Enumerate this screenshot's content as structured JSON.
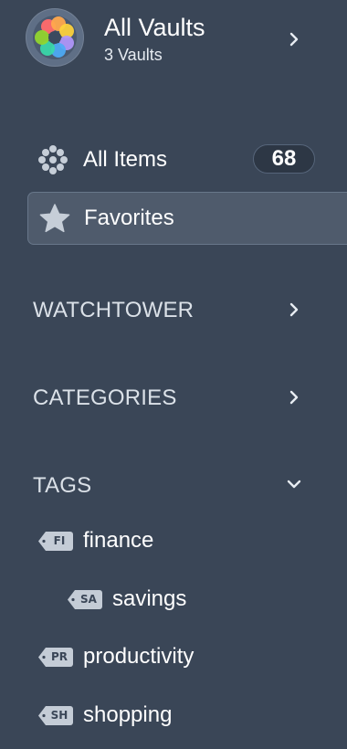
{
  "vault": {
    "title": "All Vaults",
    "subtitle": "3 Vaults",
    "icon": "rainbow-vault-icon",
    "chevron_icon": "chevron-right-icon"
  },
  "nav": [
    {
      "label": "All Items",
      "count": "68",
      "icon": "all-items-dots-icon",
      "selected": false
    },
    {
      "label": "Favorites",
      "icon": "star-icon",
      "selected": true
    }
  ],
  "sections": {
    "watchtower": {
      "label": "WATCHTOWER",
      "icon": "chevron-right-icon",
      "expanded": false
    },
    "categories": {
      "label": "CATEGORIES",
      "icon": "chevron-right-icon",
      "expanded": false
    },
    "tags": {
      "label": "TAGS",
      "icon": "chevron-down-icon",
      "expanded": true
    }
  },
  "tags": [
    {
      "abbr": "FI",
      "label": "finance",
      "level": 0
    },
    {
      "abbr": "SA",
      "label": "savings",
      "level": 1
    },
    {
      "abbr": "PR",
      "label": "productivity",
      "level": 0
    },
    {
      "abbr": "SH",
      "label": "shopping",
      "level": 0
    }
  ],
  "colors": {
    "sidebar_bg": "#3a4657",
    "selected_bg": "#4f5b6c",
    "badge_bg": "#2d3745",
    "tag_icon": "#c4ccd6"
  }
}
